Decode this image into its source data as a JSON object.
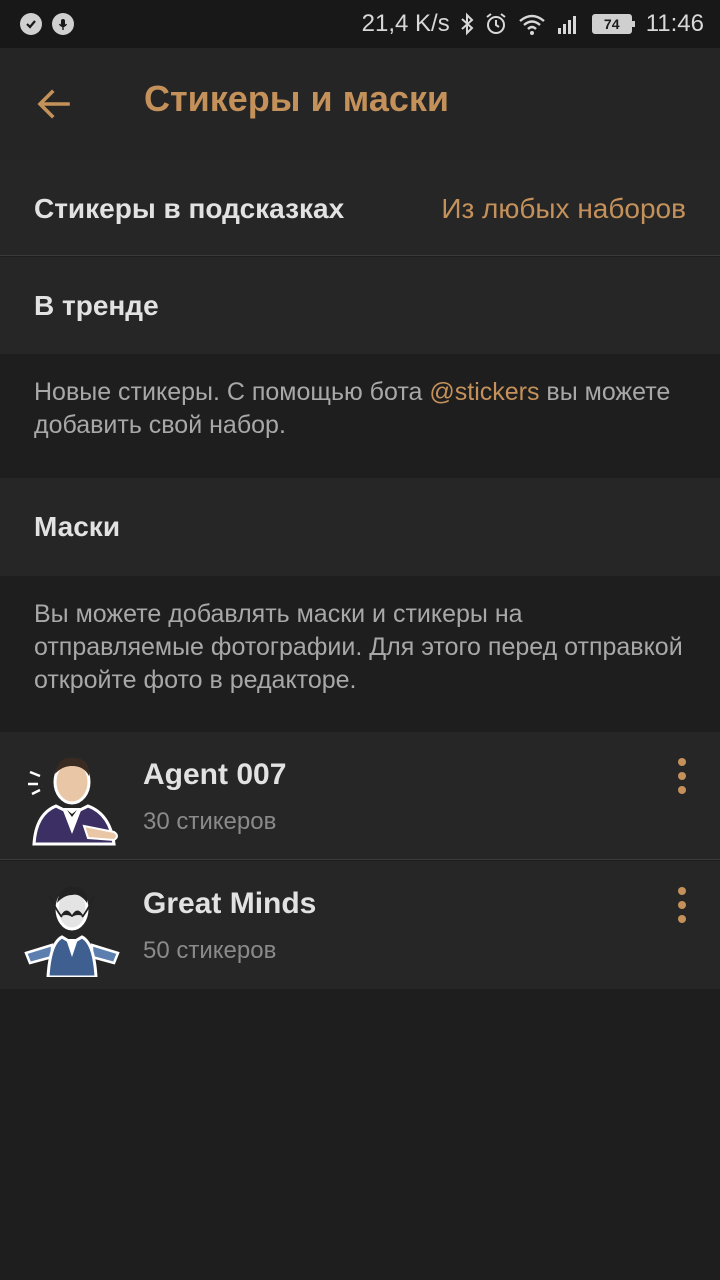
{
  "status_bar": {
    "speed": "21,4 K/s",
    "battery": "74",
    "time": "11:46"
  },
  "header": {
    "title": "Стикеры и маски"
  },
  "suggestions": {
    "label": "Стикеры в подсказках",
    "value": "Из любых наборов"
  },
  "trending": {
    "label": "В тренде"
  },
  "info_new": {
    "text_before": "Новые стикеры. С помощью бота ",
    "link": "@stickers",
    "text_after": " вы можете добавить свой набор."
  },
  "masks": {
    "label": "Маски"
  },
  "info_masks": {
    "text": "Вы можете добавлять маски и стикеры на отправляемые фотографии. Для этого перед отправкой откройте фото в редакторе."
  },
  "sticker_sets": [
    {
      "name": "Agent 007",
      "count": "30 стикеров",
      "icon": "agent-sticker-icon"
    },
    {
      "name": "Great Minds",
      "count": "50 стикеров",
      "icon": "great-minds-sticker-icon"
    }
  ],
  "colors": {
    "accent": "#c4915a",
    "background": "#1e1e1e",
    "surface": "#262626"
  }
}
